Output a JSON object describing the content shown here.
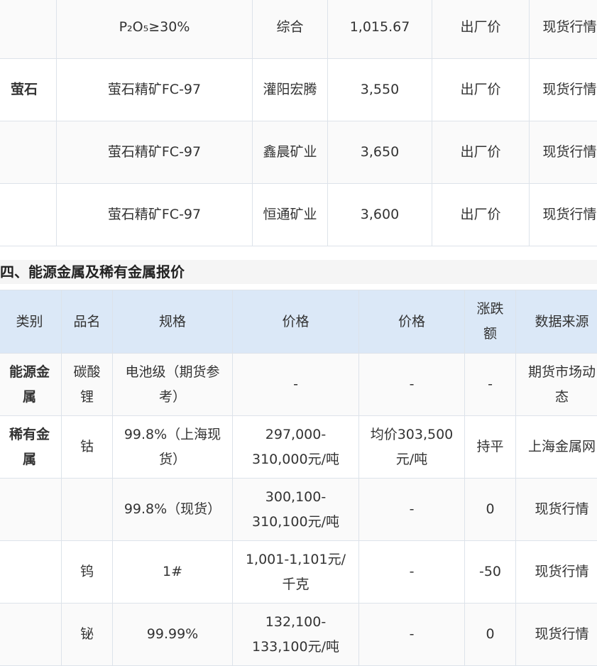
{
  "top_table": {
    "rows": [
      {
        "category": "",
        "product": "P₂O₅≥30%",
        "source_company": "综合",
        "price": "1,015.67",
        "price_type": "出厂价",
        "data_source": "现货行情"
      },
      {
        "category": "萤石",
        "product": "萤石精矿FC-97",
        "source_company": "灌阳宏腾",
        "price": "3,550",
        "price_type": "出厂价",
        "data_source": "现货行情"
      },
      {
        "category": "",
        "product": "萤石精矿FC-97",
        "source_company": "鑫晨矿业",
        "price": "3,650",
        "price_type": "出厂价",
        "data_source": "现货行情"
      },
      {
        "category": "",
        "product": "萤石精矿FC-97",
        "source_company": "恒通矿业",
        "price": "3,600",
        "price_type": "出厂价",
        "data_source": "现货行情"
      }
    ]
  },
  "section_heading": "四、能源金属及稀有金属报价",
  "bottom_table": {
    "headers": [
      "类别",
      "品名",
      "规格",
      "价格",
      "价格",
      "涨跌额",
      "数据来源"
    ],
    "rows": [
      {
        "category": "能源金属",
        "name": "碳酸锂",
        "spec": "电池级（期货参考）",
        "price": "-",
        "price2": "-",
        "change": "-",
        "source": "期货市场动态"
      },
      {
        "category": "稀有金属",
        "name": "钴",
        "spec": "99.8%（上海现货）",
        "price": "297,000-310,000元/吨",
        "price2": "均价303,500元/吨",
        "change": "持平",
        "source": "上海金属网"
      },
      {
        "category": "",
        "name": "",
        "spec": "99.8%（现货）",
        "price": "300,100-310,100元/吨",
        "price2": "-",
        "change": "0",
        "source": "现货行情"
      },
      {
        "category": "",
        "name": "钨",
        "spec": "1#",
        "price": "1,001-1,101元/千克",
        "price2": "-",
        "change": "-50",
        "source": "现货行情"
      },
      {
        "category": "",
        "name": "铋",
        "spec": "99.99%",
        "price": "132,100-133,100元/吨",
        "price2": "-",
        "change": "0",
        "source": "现货行情"
      }
    ]
  }
}
